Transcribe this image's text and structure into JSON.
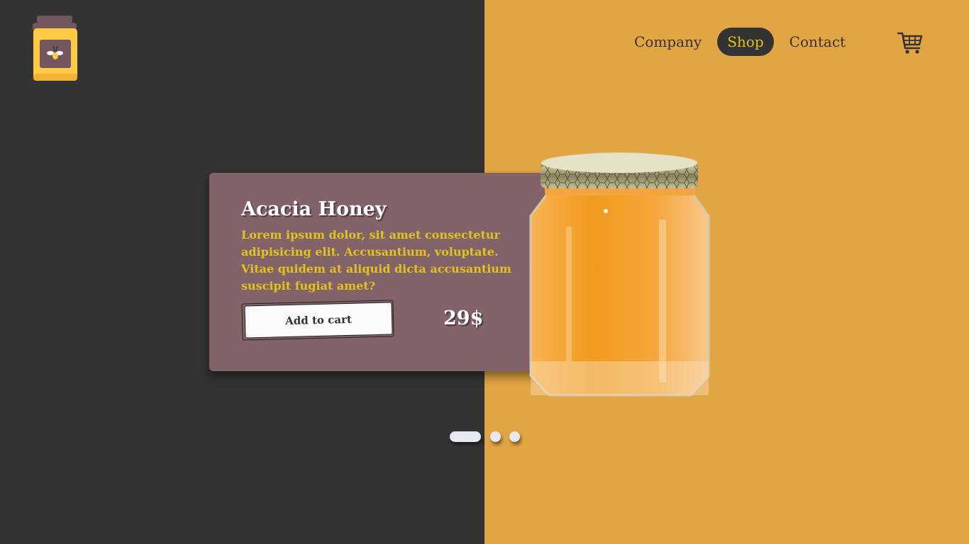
{
  "nav": {
    "items": [
      {
        "label": "Company",
        "active": false
      },
      {
        "label": "Shop",
        "active": true
      },
      {
        "label": "Contact",
        "active": false
      }
    ],
    "cart_icon": "shopping-cart-icon"
  },
  "logo": {
    "icon": "honey-jar-bee-icon"
  },
  "product": {
    "title": "Acacia Honey",
    "description": "Lorem ipsum dolor, sit amet consectetur adipisicing elit. Accusantium, voluptate. Vitae quidem at aliquid dicta accusantium suscipit fugiat amet?",
    "button_label": "Add to cart",
    "price": "29$"
  },
  "carousel": {
    "count": 3,
    "active_index": 0
  },
  "colors": {
    "left_bg": "#333333",
    "right_bg": "#E2A543",
    "card_bg": "#83636A",
    "accent_yellow": "#E2C21C",
    "honey": "#F29A1E"
  }
}
